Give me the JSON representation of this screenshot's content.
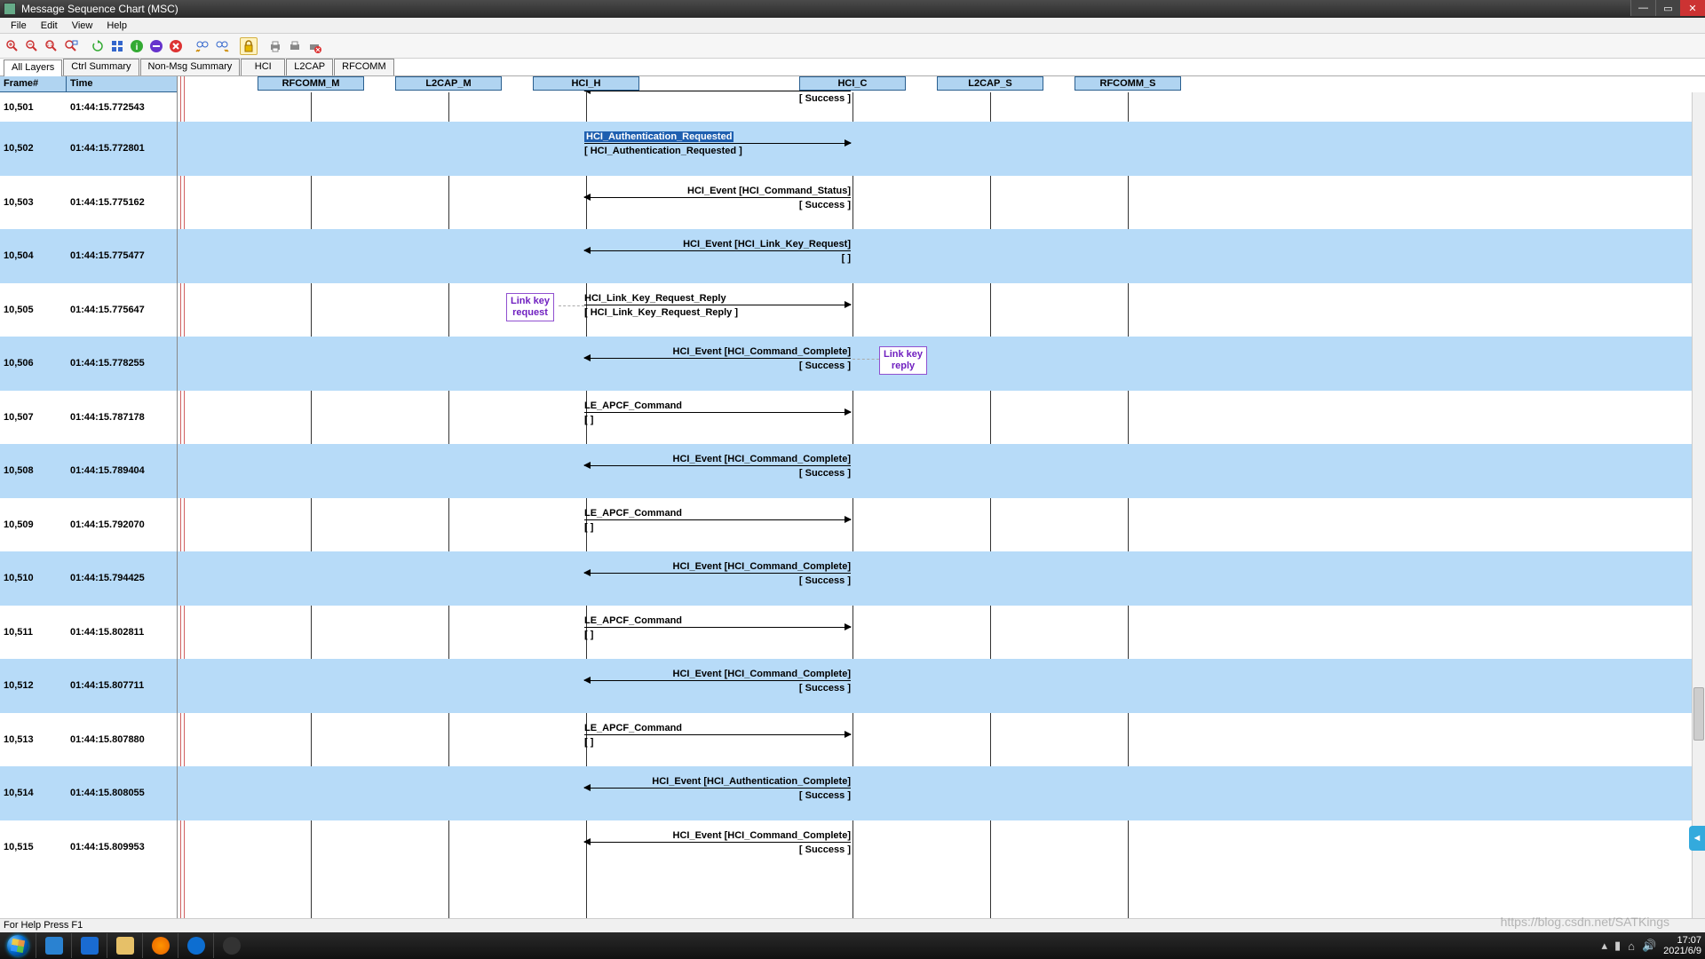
{
  "window": {
    "title": "Message Sequence Chart (MSC)"
  },
  "menu": {
    "file": "File",
    "edit": "Edit",
    "view": "View",
    "help": "Help"
  },
  "tabs": {
    "all": "All Layers",
    "ctrl": "Ctrl Summary",
    "nonmsg": "Non-Msg Summary",
    "hci": "HCI",
    "l2cap": "L2CAP",
    "rfcomm": "RFCOMM"
  },
  "grid": {
    "col1": "Frame#",
    "col2": "Time",
    "rows": [
      {
        "frame": "10,501",
        "time": "01:44:15.772543"
      },
      {
        "frame": "10,502",
        "time": "01:44:15.772801"
      },
      {
        "frame": "10,503",
        "time": "01:44:15.775162"
      },
      {
        "frame": "10,504",
        "time": "01:44:15.775477"
      },
      {
        "frame": "10,505",
        "time": "01:44:15.775647"
      },
      {
        "frame": "10,506",
        "time": "01:44:15.778255"
      },
      {
        "frame": "10,507",
        "time": "01:44:15.787178"
      },
      {
        "frame": "10,508",
        "time": "01:44:15.789404"
      },
      {
        "frame": "10,509",
        "time": "01:44:15.792070"
      },
      {
        "frame": "10,510",
        "time": "01:44:15.794425"
      },
      {
        "frame": "10,511",
        "time": "01:44:15.802811"
      },
      {
        "frame": "10,512",
        "time": "01:44:15.807711"
      },
      {
        "frame": "10,513",
        "time": "01:44:15.807880"
      },
      {
        "frame": "10,514",
        "time": "01:44:15.808055"
      },
      {
        "frame": "10,515",
        "time": "01:44:15.809953"
      }
    ]
  },
  "lifelines": {
    "rfcomm_m": "RFCOMM_M",
    "l2cap_m": "L2CAP_M",
    "hci_h": "HCI_H",
    "hci_c": "HCI_C",
    "l2cap_s": "L2CAP_S",
    "rfcomm_s": "RFCOMM_S"
  },
  "messages": {
    "m501a_sub": "[ Success ]",
    "m502a": "HCI_Authentication_Requested",
    "m502b": "[ HCI_Authentication_Requested ]",
    "m503a": "HCI_Event [HCI_Command_Status]",
    "m503b": "[ Success ]",
    "m504a": "HCI_Event [HCI_Link_Key_Request]",
    "m504b": "[  ]",
    "m505a": "HCI_Link_Key_Request_Reply",
    "m505b": "[ HCI_Link_Key_Request_Reply ]",
    "m506a": "HCI_Event [HCI_Command_Complete]",
    "m506b": "[ Success ]",
    "m507a": "LE_APCF_Command",
    "m507b": "[  ]",
    "m508a": "HCI_Event [HCI_Command_Complete]",
    "m508b": "[ Success ]",
    "m509a": "LE_APCF_Command",
    "m509b": "[  ]",
    "m510a": "HCI_Event [HCI_Command_Complete]",
    "m510b": "[ Success ]",
    "m511a": "LE_APCF_Command",
    "m511b": "[  ]",
    "m512a": "HCI_Event [HCI_Command_Complete]",
    "m512b": "[ Success ]",
    "m513a": "LE_APCF_Command",
    "m513b": "[  ]",
    "m514a": "HCI_Event [HCI_Authentication_Complete]",
    "m514b": "[ Success ]",
    "m515a": "HCI_Event [HCI_Command_Complete]",
    "m515b": "[ Success ]"
  },
  "notes": {
    "link_key_request_l1": "Link key",
    "link_key_request_l2": "request",
    "link_key_reply_l1": "Link key",
    "link_key_reply_l2": "reply"
  },
  "status": {
    "text": "For Help Press F1"
  },
  "tray": {
    "time": "17:07",
    "date": "2021/6/9"
  },
  "watermark": {
    "text": "https://blog.csdn.net/SATKings"
  },
  "chart_data": {
    "type": "sequence-diagram",
    "lifelines": [
      "RFCOMM_M",
      "L2CAP_M",
      "HCI_H",
      "HCI_C",
      "L2CAP_S",
      "RFCOMM_S"
    ],
    "events": [
      {
        "frame": 10501,
        "time": "01:44:15.772543",
        "from": "HCI_C",
        "to": "HCI_H",
        "label": "",
        "result": "[ Success ]"
      },
      {
        "frame": 10502,
        "time": "01:44:15.772801",
        "from": "HCI_H",
        "to": "HCI_C",
        "label": "HCI_Authentication_Requested",
        "detail": "[ HCI_Authentication_Requested ]",
        "highlighted": true
      },
      {
        "frame": 10503,
        "time": "01:44:15.775162",
        "from": "HCI_C",
        "to": "HCI_H",
        "label": "HCI_Event [HCI_Command_Status]",
        "result": "[ Success ]"
      },
      {
        "frame": 10504,
        "time": "01:44:15.775477",
        "from": "HCI_C",
        "to": "HCI_H",
        "label": "HCI_Event [HCI_Link_Key_Request]",
        "result": "[  ]"
      },
      {
        "frame": 10505,
        "time": "01:44:15.775647",
        "from": "HCI_H",
        "to": "HCI_C",
        "label": "HCI_Link_Key_Request_Reply",
        "detail": "[ HCI_Link_Key_Request_Reply ]",
        "note": "Link key request"
      },
      {
        "frame": 10506,
        "time": "01:44:15.778255",
        "from": "HCI_C",
        "to": "HCI_H",
        "label": "HCI_Event [HCI_Command_Complete]",
        "result": "[ Success ]",
        "note": "Link key reply"
      },
      {
        "frame": 10507,
        "time": "01:44:15.787178",
        "from": "HCI_H",
        "to": "HCI_C",
        "label": "LE_APCF_Command",
        "detail": "[  ]"
      },
      {
        "frame": 10508,
        "time": "01:44:15.789404",
        "from": "HCI_C",
        "to": "HCI_H",
        "label": "HCI_Event [HCI_Command_Complete]",
        "result": "[ Success ]"
      },
      {
        "frame": 10509,
        "time": "01:44:15.792070",
        "from": "HCI_H",
        "to": "HCI_C",
        "label": "LE_APCF_Command",
        "detail": "[  ]"
      },
      {
        "frame": 10510,
        "time": "01:44:15.794425",
        "from": "HCI_C",
        "to": "HCI_H",
        "label": "HCI_Event [HCI_Command_Complete]",
        "result": "[ Success ]"
      },
      {
        "frame": 10511,
        "time": "01:44:15.802811",
        "from": "HCI_H",
        "to": "HCI_C",
        "label": "LE_APCF_Command",
        "detail": "[  ]"
      },
      {
        "frame": 10512,
        "time": "01:44:15.807711",
        "from": "HCI_C",
        "to": "HCI_H",
        "label": "HCI_Event [HCI_Command_Complete]",
        "result": "[ Success ]"
      },
      {
        "frame": 10513,
        "time": "01:44:15.807880",
        "from": "HCI_H",
        "to": "HCI_C",
        "label": "LE_APCF_Command",
        "detail": "[  ]"
      },
      {
        "frame": 10514,
        "time": "01:44:15.808055",
        "from": "HCI_C",
        "to": "HCI_H",
        "label": "HCI_Event [HCI_Authentication_Complete]",
        "result": "[ Success ]"
      },
      {
        "frame": 10515,
        "time": "01:44:15.809953",
        "from": "HCI_C",
        "to": "HCI_H",
        "label": "HCI_Event [HCI_Command_Complete]",
        "result": "[ Success ]"
      }
    ]
  }
}
